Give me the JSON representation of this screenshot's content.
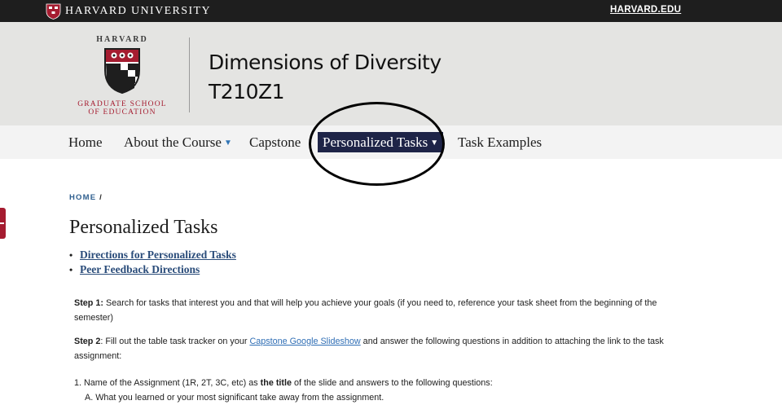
{
  "topbar": {
    "university": "HARVARD UNIVERSITY",
    "link": "HARVARD.EDU"
  },
  "logo": {
    "harvard": "HARVARD",
    "school_line1": "GRADUATE SCHOOL",
    "school_line2": "OF EDUCATION"
  },
  "site": {
    "title_line1": "Dimensions of Diversity",
    "title_line2": "T210Z1"
  },
  "nav": {
    "items": [
      {
        "label": "Home"
      },
      {
        "label": "About the Course",
        "caret": "▼"
      },
      {
        "label": "Capstone"
      },
      {
        "label": "Personalized Tasks",
        "caret": "▼",
        "active": true
      },
      {
        "label": "Task Examples"
      }
    ]
  },
  "breadcrumb": {
    "home": "HOME",
    "sep": "/"
  },
  "page": {
    "title": "Personalized Tasks",
    "links": [
      "Directions for Personalized Tasks",
      "Peer Feedback Directions"
    ],
    "step1_label": "Step 1:",
    "step1_text": " Search for tasks that interest you and that will help you achieve your goals (if you need to, reference your task sheet from the beginning of the semester)",
    "step2_label": "Step 2",
    "step2_text_a": ": Fill out the table task tracker on your ",
    "step2_link": "Capstone Google Slideshow",
    "step2_text_b": " and answer the following questions in addition to attaching the link to the task assignment:",
    "item1_a": "1. Name of the Assignment (1R, 2T, 3C, etc) as ",
    "item1_bold": "the title",
    "item1_b": " of the slide and answers to the following questions:",
    "item1_sub_a": "A. What you learned or your most significant take away from the assignment."
  },
  "colors": {
    "accent": "#a51c30",
    "nav_active_bg": "#1e2447",
    "link": "#2a4c7a"
  }
}
